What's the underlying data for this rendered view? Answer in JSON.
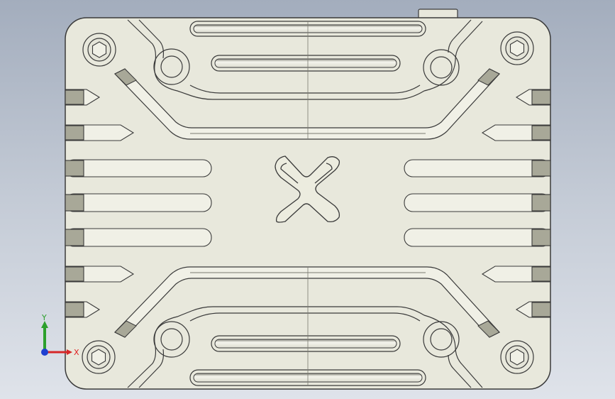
{
  "view": {
    "background_top": "#a3adbd",
    "background_bottom": "#dfe3ea",
    "part_fill": "#e8e8dc",
    "part_stroke": "#3a3a3a",
    "groove_fill": "#f2f2ea",
    "groove_shadow": "#9a9a8e"
  },
  "triad": {
    "y_label": "Y",
    "x_label": "X",
    "y_color": "#2ca02c",
    "x_color": "#d62728",
    "z_color": "#1f3fd0"
  }
}
